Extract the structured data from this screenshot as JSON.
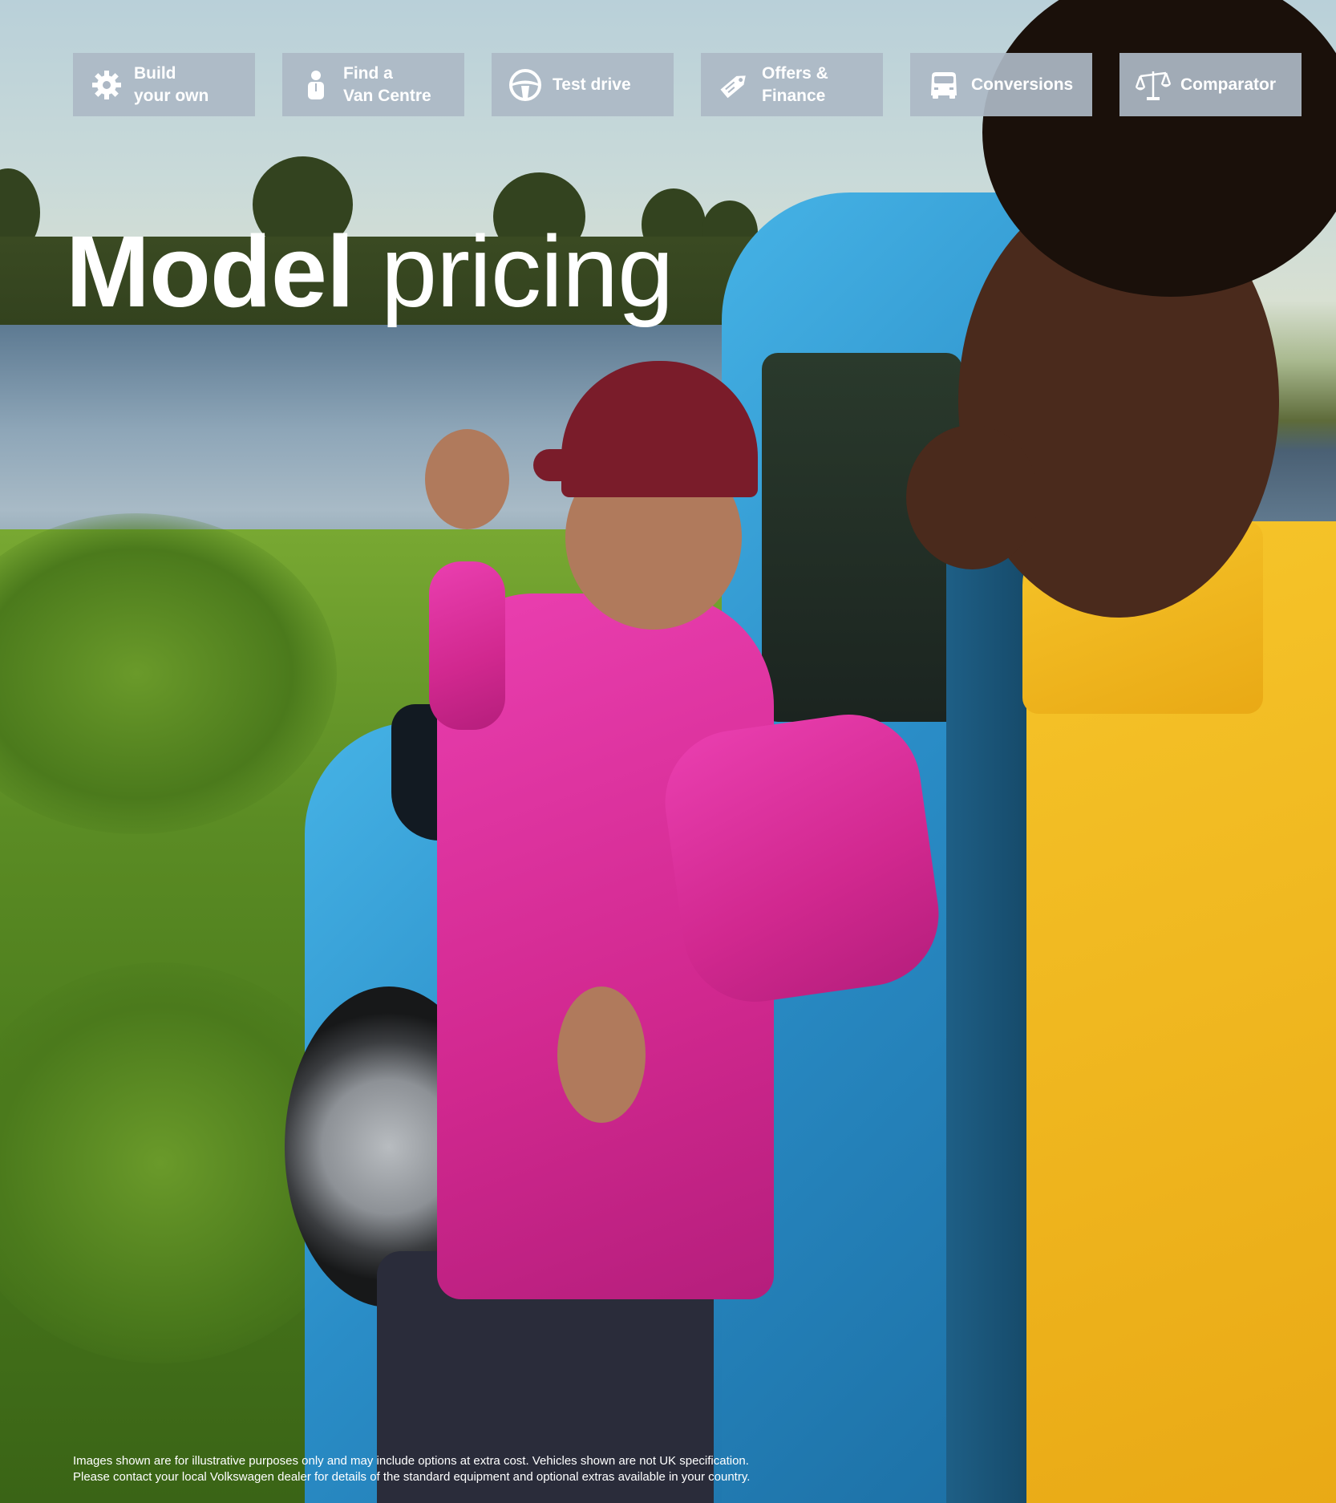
{
  "nav": {
    "items": [
      {
        "label": "Build\nyour own",
        "icon": "gear-icon"
      },
      {
        "label": "Find a\nVan Centre",
        "icon": "person-icon"
      },
      {
        "label": "Test drive",
        "icon": "steering-wheel-icon"
      },
      {
        "label": "Offers &\nFinance",
        "icon": "price-tag-icon"
      },
      {
        "label": "Conversions",
        "icon": "van-icon"
      },
      {
        "label": "Comparator",
        "icon": "scales-icon"
      }
    ]
  },
  "title": {
    "bold": "Model",
    "light": "pricing"
  },
  "disclaimer": {
    "line1": "Images shown are for illustrative purposes only and may include options at extra cost. Vehicles shown are not UK specification.",
    "line2": "Please contact your local Volkswagen dealer for details of the standard equipment and optional extras available in your country."
  },
  "colors": {
    "tile_bg": "#adb8c5",
    "text": "#ffffff",
    "van": "#2a8dc7",
    "jacket": "#d1288f",
    "shirt": "#f6c52a"
  }
}
